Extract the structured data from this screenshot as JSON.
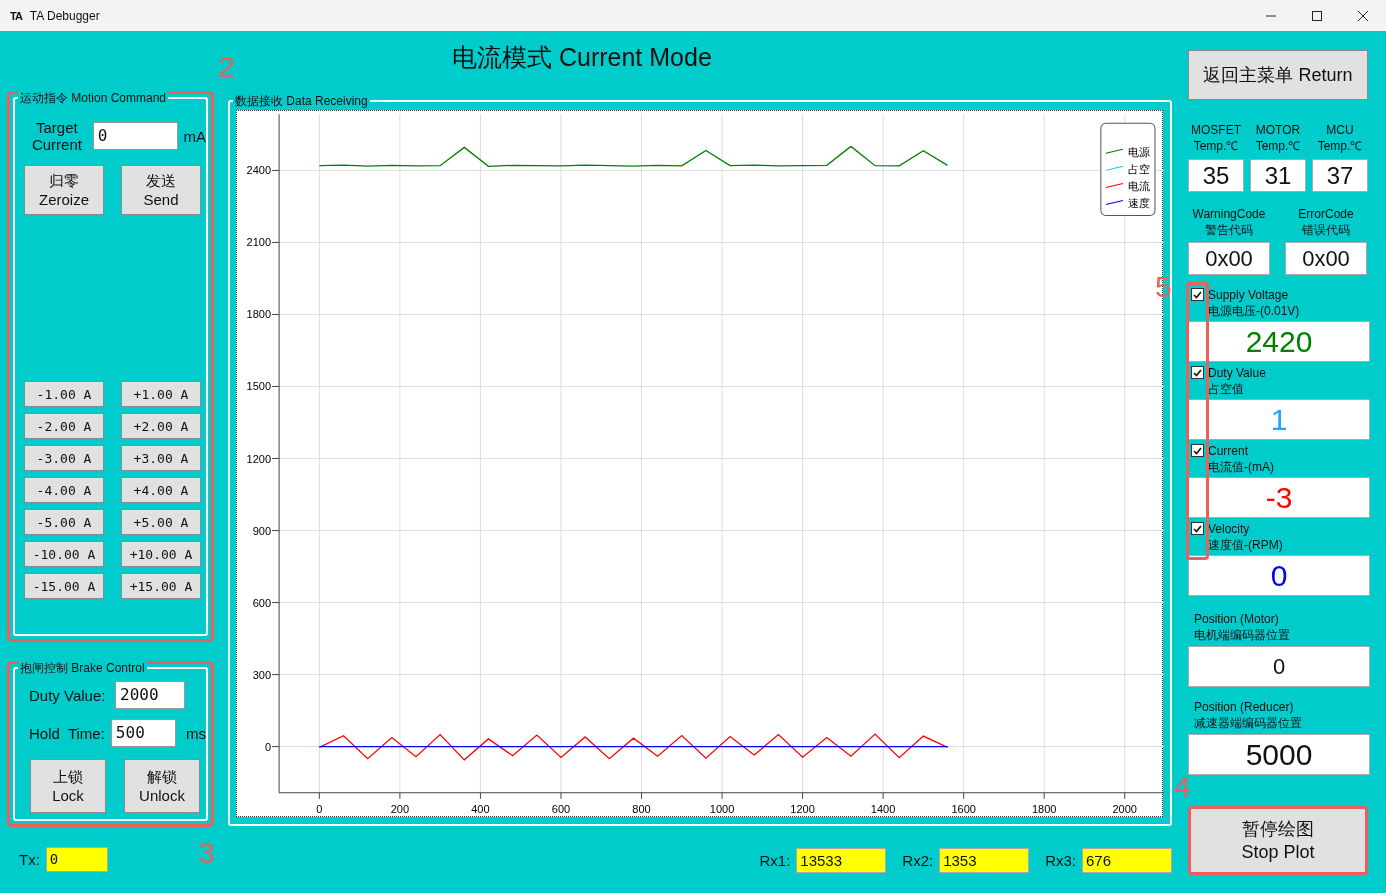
{
  "window": {
    "title": "TA Debugger",
    "icon": "TA"
  },
  "page_title": "电流模式 Current Mode",
  "motion_command": {
    "legend": "运动指令 Motion Command",
    "highlighted": true,
    "target_label": "Target Current",
    "target_value": "0",
    "unit": "mA",
    "buttons": [
      "归零\nZeroize",
      "发送\nSend"
    ],
    "steps": [
      {
        "minus": "-1.00 A",
        "plus": "+1.00 A"
      },
      {
        "minus": "-2.00 A",
        "plus": "+2.00 A"
      },
      {
        "minus": "-3.00 A",
        "plus": "+3.00 A"
      },
      {
        "minus": "-4.00 A",
        "plus": "+4.00 A"
      },
      {
        "minus": "-5.00 A",
        "plus": "+5.00 A"
      },
      {
        "minus": "-10.00 A",
        "plus": "+10.00 A"
      },
      {
        "minus": "-15.00 A",
        "plus": "+15.00 A"
      }
    ]
  },
  "brake_control": {
    "legend": "抱闸控制 Brake Control",
    "highlighted": true,
    "duty_label": "Duty Value:",
    "duty_value": "2000",
    "hold_label": "Hold  Time:",
    "hold_value": "500",
    "unit": "ms",
    "buttons": [
      "上锁\nLock",
      "解锁\nUnlock"
    ]
  },
  "tx": {
    "label": "Tx:",
    "value": "0"
  },
  "data_receiving": {
    "legend": "数据接收 Data Receiving",
    "chart_data": {
      "type": "line",
      "grid": true,
      "legend": true,
      "xlim": [
        -100,
        2100
      ],
      "ylim": [
        -192,
        2634
      ],
      "xticks": [
        0,
        200,
        400,
        600,
        800,
        1000,
        1200,
        1400,
        1600,
        1800,
        2000
      ],
      "yticks": [
        0,
        300,
        600,
        900,
        1200,
        1500,
        1800,
        2100,
        2400
      ],
      "x": [
        0,
        60,
        120,
        180,
        240,
        300,
        360,
        420,
        480,
        540,
        600,
        660,
        720,
        780,
        840,
        900,
        960,
        1020,
        1080,
        1140,
        1200,
        1260,
        1320,
        1380,
        1440,
        1500,
        1560
      ],
      "series": [
        {
          "name": "电源",
          "color": "#008000",
          "values": [
            2420,
            2422,
            2418,
            2421,
            2419,
            2420,
            2496,
            2417,
            2421,
            2420,
            2419,
            2422,
            2420,
            2418,
            2421,
            2419,
            2483,
            2420,
            2422,
            2419,
            2420,
            2421,
            2500,
            2420,
            2419,
            2482,
            2421
          ]
        },
        {
          "name": "占空",
          "color": "#00bfff",
          "values": [
            null,
            null,
            null,
            null,
            null,
            null,
            null,
            null,
            null,
            null,
            null,
            null,
            null,
            null,
            null,
            null,
            null,
            null,
            null,
            null,
            null,
            null,
            null,
            null,
            null,
            null,
            null
          ]
        },
        {
          "name": "电流",
          "color": "#ff0000",
          "values": [
            -3,
            45,
            -50,
            38,
            -42,
            50,
            -55,
            32,
            -38,
            48,
            -45,
            40,
            -50,
            35,
            -40,
            46,
            -48,
            42,
            -35,
            50,
            -44,
            38,
            -40,
            52,
            -46,
            44,
            -3
          ]
        },
        {
          "name": "速度",
          "color": "#0000ff",
          "values": [
            0,
            0,
            0,
            0,
            0,
            0,
            0,
            0,
            0,
            0,
            0,
            0,
            0,
            0,
            0,
            0,
            0,
            0,
            0,
            0,
            0,
            0,
            0,
            0,
            0,
            0,
            0
          ]
        }
      ]
    }
  },
  "rx": [
    {
      "label": "Rx1:",
      "value": "13533"
    },
    {
      "label": "Rx2:",
      "value": "1353"
    },
    {
      "label": "Rx3:",
      "value": "676"
    }
  ],
  "return_button": "返回主菜单 Return",
  "temperatures": [
    {
      "label": "MOSFET\nTemp.℃",
      "value": "35"
    },
    {
      "label": "MOTOR\nTemp.℃",
      "value": "31"
    },
    {
      "label": "MCU\nTemp.℃",
      "value": "37"
    }
  ],
  "codes": [
    {
      "label": "WarningCode\n警告代码",
      "value": "0x00"
    },
    {
      "label": "ErrorCode\n错误代码",
      "value": "0x00"
    }
  ],
  "channels_highlighted": true,
  "channels": [
    {
      "label": "Supply Voltage\n电源电压-(0.01V)",
      "checked": true,
      "value": "2420",
      "color": "#008000"
    },
    {
      "label": "Duty Value\n占空值",
      "checked": true,
      "value": "1",
      "color": "#1ea7ff"
    },
    {
      "label": "Current\n电流值-(mA)",
      "checked": true,
      "value": "-3",
      "color": "#ff0000"
    },
    {
      "label": "Velocity\n速度值-(RPM)",
      "checked": true,
      "value": "0",
      "color": "#0000ff"
    }
  ],
  "positions": [
    {
      "label": "Position (Motor)\n电机端编码器位置",
      "value": "0"
    },
    {
      "label": "Position (Reducer)\n减速器端编码器位置",
      "value": "5000"
    }
  ],
  "stop_plot": {
    "label": "暂停绘图\nStop Plot",
    "highlighted": true
  },
  "annotations": [
    "2",
    "3",
    "4",
    "5"
  ]
}
